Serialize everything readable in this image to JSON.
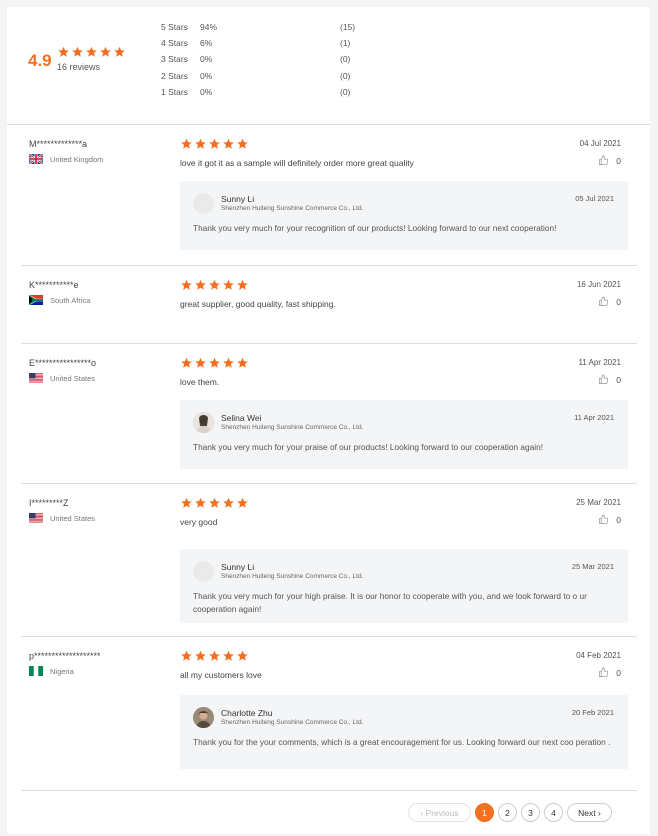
{
  "summary": {
    "score": "4.9",
    "total": "16 reviews",
    "distribution": [
      {
        "label": "5 Stars",
        "pct": "94%",
        "count": "(15)"
      },
      {
        "label": "4 Stars",
        "pct": "6%",
        "count": "(1)"
      },
      {
        "label": "3 Stars",
        "pct": "0%",
        "count": "(0)"
      },
      {
        "label": "2 Stars",
        "pct": "0%",
        "count": "(0)"
      },
      {
        "label": "1 Stars",
        "pct": "0%",
        "count": "(0)"
      }
    ]
  },
  "reviews": [
    {
      "name": "M*************a",
      "country": "United Kingdom",
      "rating": 5,
      "date": "04 Jul 2021",
      "text": "love it got it as a sample will definitely order more great quality",
      "likes": "0",
      "reply": {
        "name": "Sunny Li",
        "company": "Shenzhen Huiteng Sunshine Commerce Co., Ltd.",
        "date": "05 Jul 2021",
        "text": "Thank you very much for your recognition of our products! Looking forward to our next cooperation!"
      }
    },
    {
      "name": "K***********e",
      "country": "South Africa",
      "rating": 5,
      "date": "16 Jun 2021",
      "text": "great supplier, good quality, fast shipping.",
      "likes": "0"
    },
    {
      "name": "E****************o",
      "country": "United States",
      "rating": 5,
      "date": "11 Apr 2021",
      "text": "love them.",
      "likes": "0",
      "reply": {
        "name": "Selina Wei",
        "company": "Shenzhen Huiteng Sunshine Commerce Co., Ltd.",
        "date": "11 Apr 2021",
        "text": "Thank you very much for your praise of our products! Looking forward to our cooperation again!"
      }
    },
    {
      "name": "I*********Z",
      "country": "United States",
      "rating": 5,
      "date": "25 Mar 2021",
      "text": "very good",
      "likes": "0",
      "reply": {
        "name": "Sunny Li",
        "company": "Shenzhen Huiteng Sunshine Commerce Co., Ltd.",
        "date": "25 Mar 2021",
        "text": "Thank you very much for your high praise. It is our honor to cooperate with you, and we look forward to o ur cooperation again!"
      }
    },
    {
      "name": "p*******************",
      "country": "Nigeria",
      "rating": 5,
      "date": "04 Feb 2021",
      "text": "all my customers love",
      "likes": "0",
      "reply": {
        "name": "Charlotte Zhu",
        "company": "Shenzhen Huiteng Sunshine Commerce Co., Ltd.",
        "date": "20 Feb 2021",
        "text": "Thank you for the your comments, which is a great encouragement for us. Looking forward our next coo peration ."
      }
    }
  ],
  "pagination": {
    "prev": "Previous",
    "pages": [
      "1",
      "2",
      "3",
      "4"
    ],
    "active": "1",
    "next": "Next"
  },
  "colors": {
    "accent": "#f37021"
  }
}
